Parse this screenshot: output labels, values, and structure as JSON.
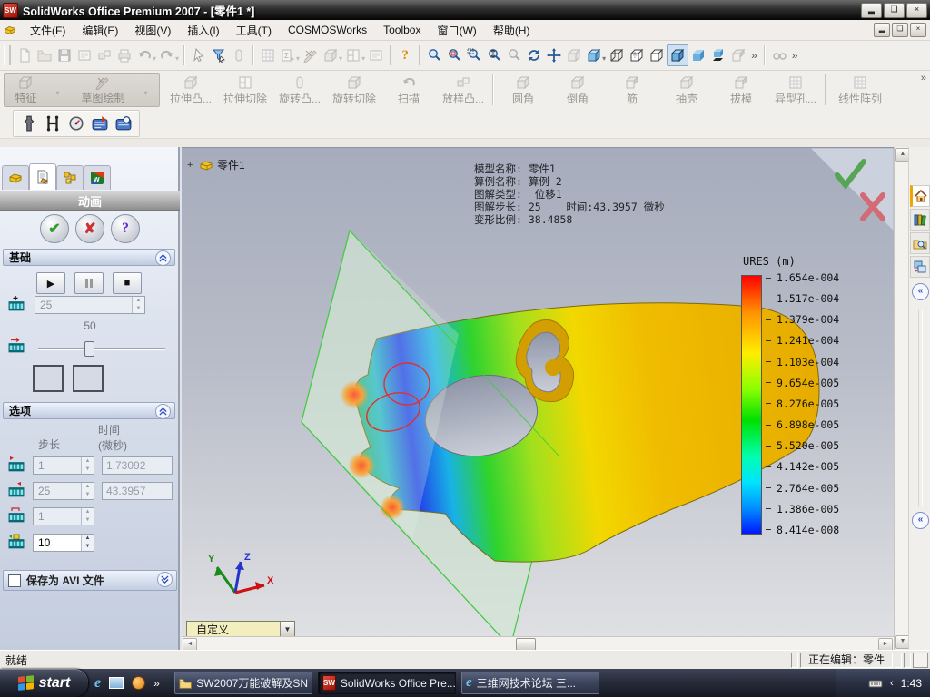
{
  "titlebar": {
    "title": "SolidWorks Office Premium 2007 - [零件1 *]"
  },
  "menubar": {
    "items": [
      "文件(F)",
      "编辑(E)",
      "视图(V)",
      "插入(I)",
      "工具(T)",
      "COSMOSWorks",
      "Toolbox",
      "窗口(W)",
      "帮助(H)"
    ]
  },
  "command_manager": {
    "tab_features": "特征",
    "tab_sketch": "草图绘制",
    "buttons": [
      "拉伸凸...",
      "拉伸切除",
      "旋转凸...",
      "旋转切除",
      "扫描",
      "放样凸...",
      "圆角",
      "倒角",
      "筋",
      "抽壳",
      "拔模",
      "异型孔...",
      "线性阵列"
    ]
  },
  "property_manager": {
    "title": "动画",
    "basics": {
      "label": "基础",
      "frames_value": "25",
      "range_max": "50"
    },
    "options": {
      "label": "选项",
      "step_header": "步长",
      "time_header_line1": "时间",
      "time_header_line2": "(微秒)",
      "start_step": "1",
      "start_time": "1.73092",
      "end_step": "25",
      "end_time": "43.3957",
      "increment": "1",
      "fps": "10"
    },
    "avi_label": "保存为 AVI 文件"
  },
  "viewport": {
    "tree_item": "零件1",
    "annotation_lines": {
      "l1": "模型名称: 零件1",
      "l2": "算例名称: 算例 2",
      "l3": "图解类型:  位移1",
      "l4": "图解步长: 25    时间:43.3957 微秒",
      "l5": "变形比例: 38.4858"
    },
    "view_combo_value": "自定义"
  },
  "legend": {
    "title": "URES (m)",
    "values": [
      "1.654e-004",
      "1.517e-004",
      "1.379e-004",
      "1.241e-004",
      "1.103e-004",
      "9.654e-005",
      "8.276e-005",
      "6.898e-005",
      "5.520e-005",
      "4.142e-005",
      "2.764e-005",
      "1.386e-005",
      "8.414e-008"
    ],
    "color_top": "#ff0000",
    "color_bottom": "#0018ff"
  },
  "triad": {
    "x": "X",
    "y": "Y",
    "z": "Z"
  },
  "statusbar": {
    "ready": "就绪",
    "editing": "正在编辑：零件"
  },
  "taskbar": {
    "start_label": "start",
    "tasks": [
      {
        "label": "SW2007万能破解及SN"
      },
      {
        "label": "SolidWorks Office Pre..."
      },
      {
        "label": "三维网技术论坛 三..."
      }
    ],
    "clock": "1:43"
  },
  "icons": {
    "ok": "✔",
    "cancel": "✘",
    "help": "?",
    "play": "▶",
    "stop": "■"
  }
}
